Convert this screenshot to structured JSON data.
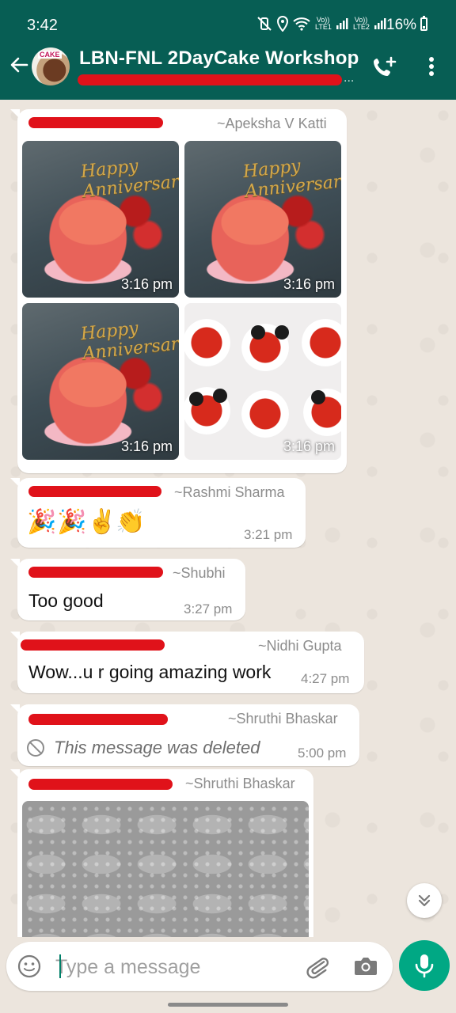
{
  "status_bar": {
    "time": "3:42",
    "volte1": "Vo)) LTE1",
    "volte2": "Vo)) LTE2",
    "battery": "16%"
  },
  "header": {
    "group_name": "LBN-FNL 2DayCake Workshop",
    "avatar_text": "CAKE",
    "subtitle_more": "..."
  },
  "messages": [
    {
      "sender": "~Apeksha V Katti",
      "photos": [
        {
          "time": "3:16 pm",
          "topper": "Happy Anniversary"
        },
        {
          "time": "3:16 pm",
          "topper": "Happy Anniversary"
        },
        {
          "time": "3:16 pm",
          "topper": "Happy Anniversary"
        },
        {
          "time": "3:16 pm"
        }
      ]
    },
    {
      "sender": "~Rashmi Sharma",
      "emojis": [
        "🎉",
        "🎉",
        "✌️",
        "👏"
      ],
      "time": "3:21 pm"
    },
    {
      "sender": "~Shubhi",
      "text": "Too good",
      "time": "3:27 pm"
    },
    {
      "sender": "~Nidhi Gupta",
      "text": "Wow...u r going amazing work",
      "time": "4:27 pm"
    },
    {
      "sender": "~Shruthi Bhaskar",
      "deleted_text": "This message was deleted",
      "time": "5:00 pm"
    },
    {
      "sender": "~Shruthi Bhaskar"
    }
  ],
  "input": {
    "placeholder": "Type a message"
  },
  "icons": {
    "back": "back-arrow-icon",
    "add_call": "add-call-icon",
    "menu": "more-vertical-icon",
    "scroll": "chevron-double-down-icon",
    "emoji": "emoji-icon",
    "attach": "paperclip-icon",
    "camera": "camera-icon",
    "mic": "microphone-icon"
  },
  "colors": {
    "header": "#075e54",
    "accent": "#00a884",
    "chat_bg": "#ece5dd",
    "redaction": "#e0121a"
  }
}
